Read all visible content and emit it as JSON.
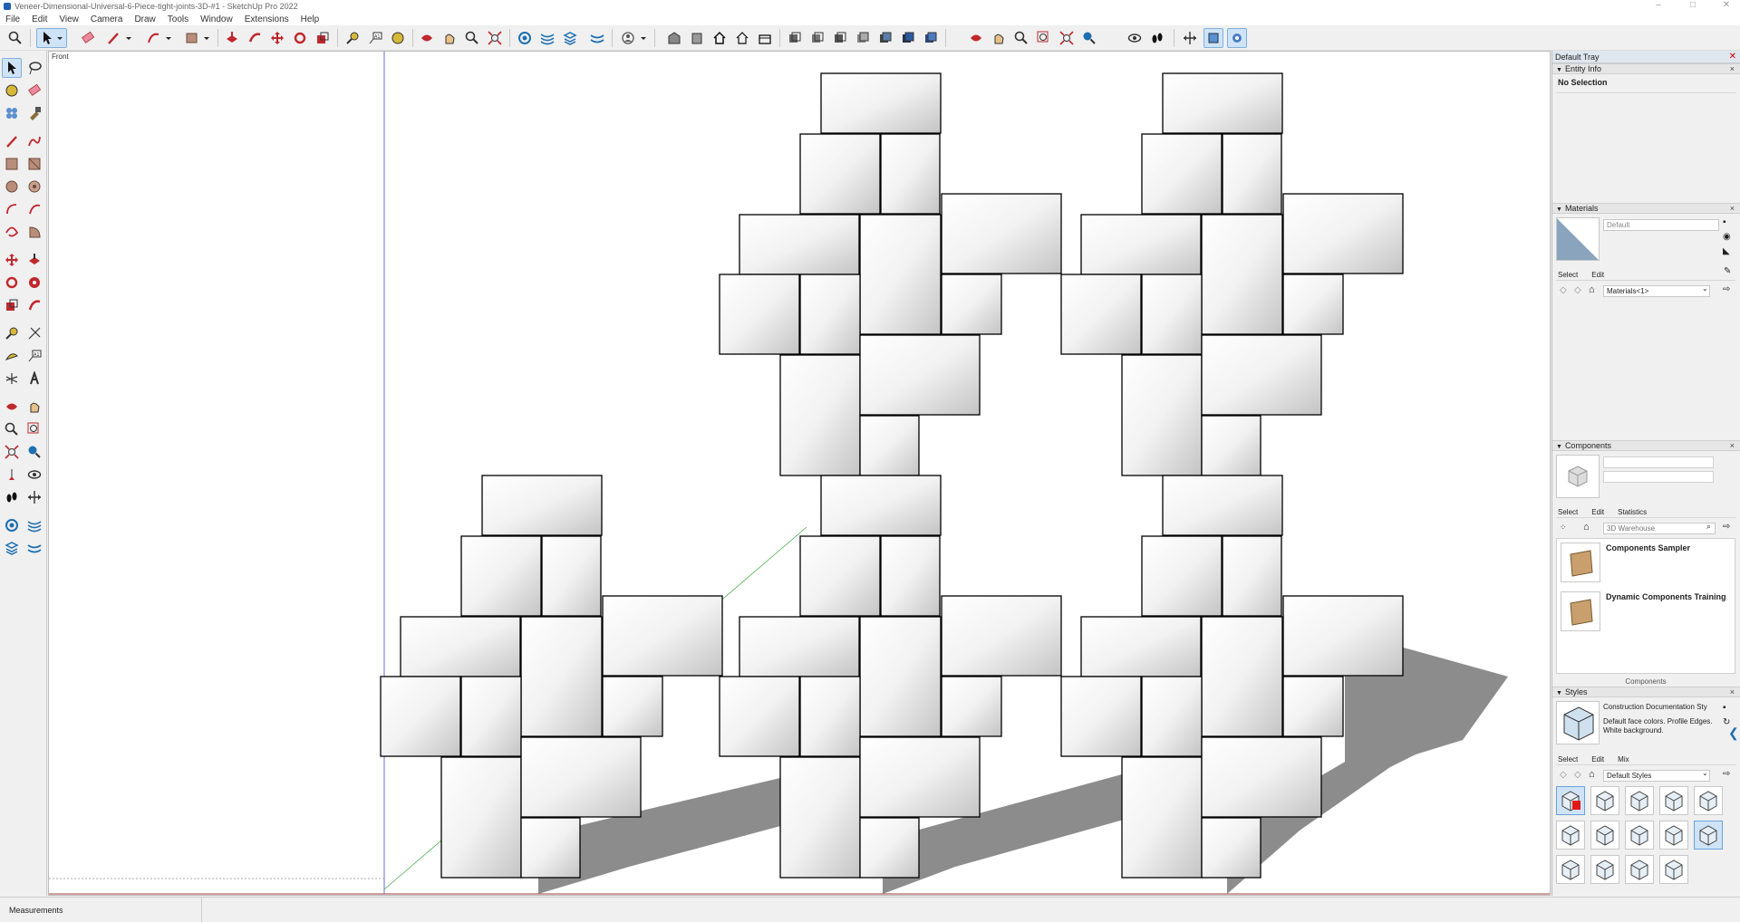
{
  "window": {
    "title": "Veneer-Dimensional-Universal-6-Piece-tight-joints-3D-#1 - SketchUp Pro 2022",
    "controls": [
      "–",
      "□",
      "✕"
    ]
  },
  "menu": [
    "File",
    "Edit",
    "View",
    "Camera",
    "Draw",
    "Tools",
    "Window",
    "Extensions",
    "Help"
  ],
  "viewport": {
    "scene_label": "Front",
    "colors": {
      "face_light": "#ffffff",
      "face_dark": "#c9c9c9",
      "shadow": "#8c8c8c",
      "edge": "#000000"
    }
  },
  "tray": {
    "title": "Default Tray",
    "entity_info": {
      "header": "Entity Info",
      "selection": "No Selection"
    },
    "materials": {
      "header": "Materials",
      "name_value": "Default",
      "tabs": [
        "Select",
        "Edit"
      ],
      "library": "Materials<1>"
    },
    "components": {
      "header": "Components",
      "tabs": [
        "Select",
        "Edit",
        "Statistics"
      ],
      "search_placeholder": "3D Warehouse",
      "items": [
        {
          "title": "Components Sampler"
        },
        {
          "title": "Dynamic Components Training"
        }
      ],
      "footer": "Components"
    },
    "styles": {
      "header": "Styles",
      "style_name": "Construction Documentation Sty",
      "style_desc": "Default face colors. Profile Edges. White background.",
      "tabs": [
        "Select",
        "Edit",
        "Mix"
      ],
      "library": "Default Styles"
    }
  },
  "status": {
    "measurements_label": "Measurements"
  }
}
